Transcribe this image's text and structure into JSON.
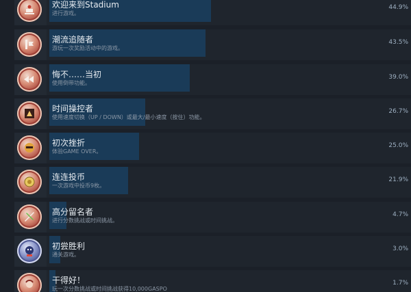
{
  "achievements": [
    {
      "title": "欢迎来到Stadium",
      "desc": "进行游戏。",
      "pct": "44.9%",
      "fill": 0.449,
      "icon": "stadium-icon",
      "badge": "red"
    },
    {
      "title": "潮流追随者",
      "desc": "游玩一次奖励活动中的游戏。",
      "pct": "43.5%",
      "fill": 0.435,
      "icon": "bonus-game-icon",
      "badge": "red"
    },
    {
      "title": "悔不……当初",
      "desc": "使用倒带功能。",
      "pct": "39.0%",
      "fill": 0.39,
      "icon": "rewind-icon",
      "badge": "red"
    },
    {
      "title": "时间操控者",
      "desc": "使用速度切换（UP / DOWN）或最大/最小速度（按住）功能。",
      "pct": "26.7%",
      "fill": 0.267,
      "icon": "speed-control-icon",
      "badge": "red"
    },
    {
      "title": "初次挫折",
      "desc": "体验GAME OVER。",
      "pct": "25.0%",
      "fill": 0.25,
      "icon": "game-over-icon",
      "badge": "red"
    },
    {
      "title": "连连投币",
      "desc": "一次游戏中投币9枚。",
      "pct": "21.9%",
      "fill": 0.219,
      "icon": "coin-icon",
      "badge": "red"
    },
    {
      "title": "高分留名者",
      "desc": "进行分数挑战或时间挑战。",
      "pct": "4.7%",
      "fill": 0.047,
      "icon": "challenge-icon",
      "badge": "red"
    },
    {
      "title": "初尝胜利",
      "desc": "通关游戏。",
      "pct": "3.0%",
      "fill": 0.03,
      "icon": "victory-icon",
      "badge": "blue"
    },
    {
      "title": "干得好！",
      "desc": "玩一次分数挑战或时间挑战获得10,000GASPO",
      "pct": "1.7%",
      "fill": 0.017,
      "icon": "good-job-icon",
      "badge": "red"
    }
  ]
}
